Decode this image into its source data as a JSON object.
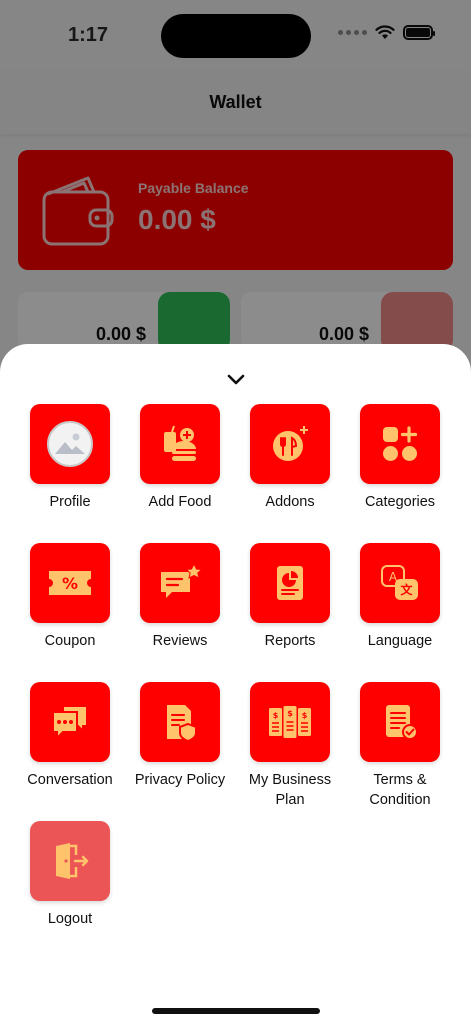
{
  "status_bar": {
    "time": "1:17"
  },
  "header": {
    "title": "Wallet"
  },
  "balance_card": {
    "label": "Payable Balance",
    "value": "0.00 $"
  },
  "mini_cards": [
    {
      "value": "0.00 $"
    },
    {
      "value": "0.00 $"
    }
  ],
  "menu": {
    "items": [
      {
        "label": "Profile",
        "icon": "avatar-icon"
      },
      {
        "label": "Add Food",
        "icon": "burger-drink-plus-icon"
      },
      {
        "label": "Addons",
        "icon": "cutlery-plus-icon"
      },
      {
        "label": "Categories",
        "icon": "grid-plus-icon"
      },
      {
        "label": "Coupon",
        "icon": "percent-ticket-icon"
      },
      {
        "label": "Reviews",
        "icon": "chat-star-icon"
      },
      {
        "label": "Reports",
        "icon": "report-chart-icon"
      },
      {
        "label": "Language",
        "icon": "translate-icon"
      },
      {
        "label": "Conversation",
        "icon": "chat-bubbles-icon"
      },
      {
        "label": "Privacy Policy",
        "icon": "document-shield-icon"
      },
      {
        "label": "My Business Plan",
        "icon": "plans-icon"
      },
      {
        "label": "Terms & Condition",
        "icon": "document-check-icon"
      },
      {
        "label": "Logout",
        "icon": "logout-icon"
      }
    ]
  },
  "colors": {
    "brand_red": "#ff0000",
    "icon_accent": "#ffc36b",
    "logout_tile": "#ec5555"
  }
}
